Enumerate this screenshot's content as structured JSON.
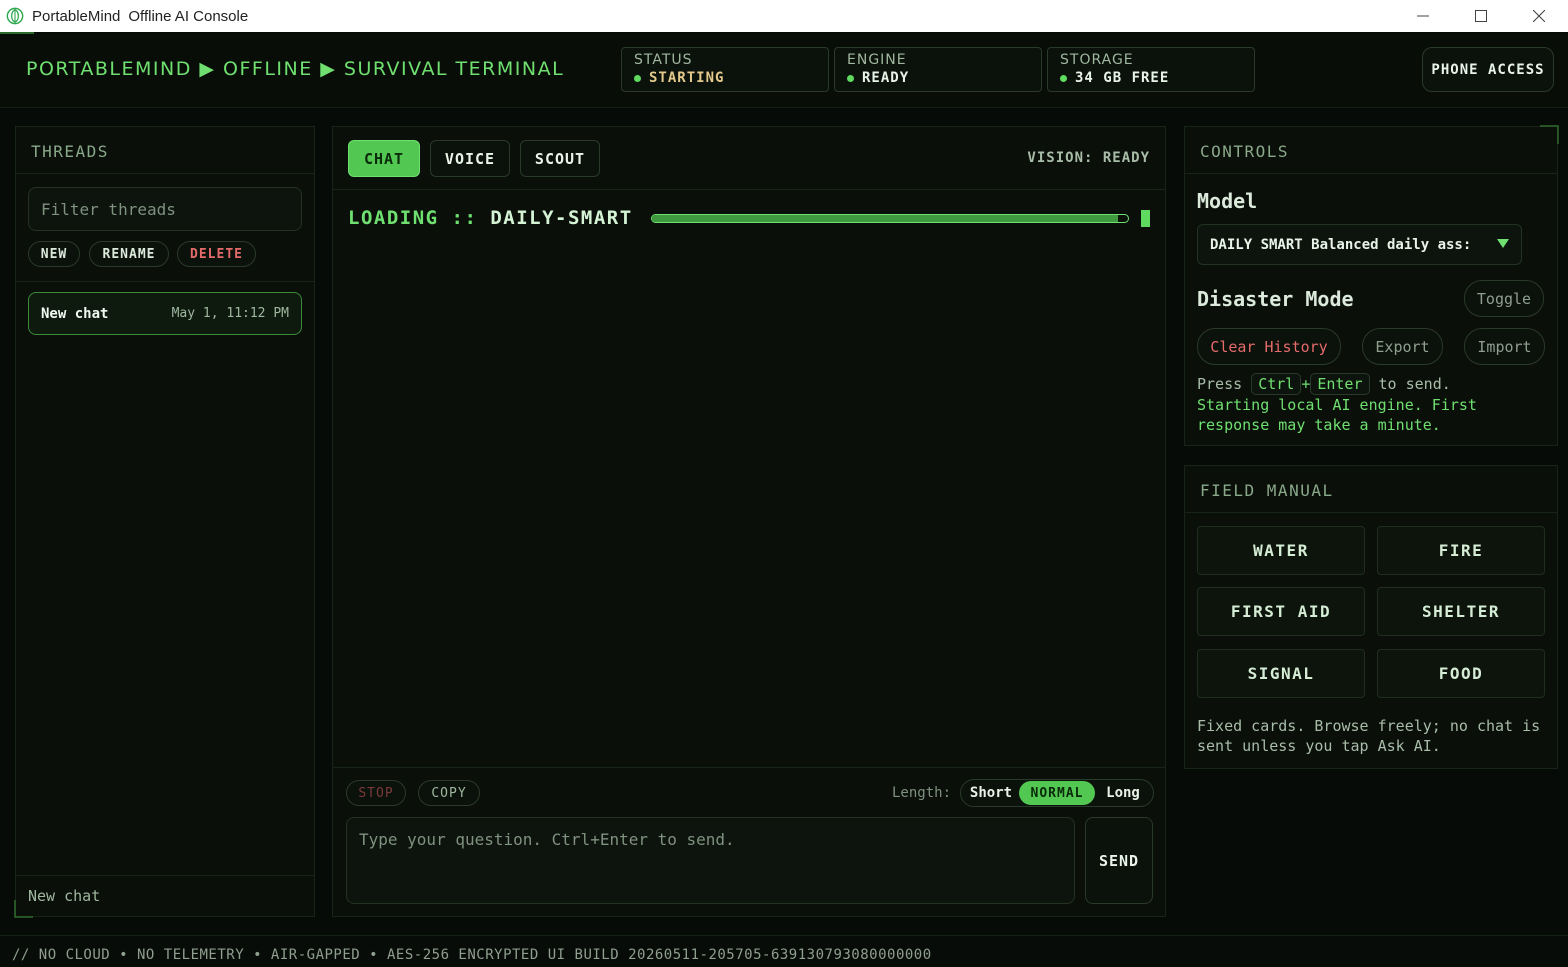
{
  "window": {
    "app_name": "PortableMind",
    "title": "Offline AI Console"
  },
  "header": {
    "brand": "PORTABLEMIND ▶ OFFLINE ▶ SURVIVAL TERMINAL",
    "status": {
      "label": "STATUS",
      "value": "STARTING"
    },
    "engine": {
      "label": "ENGINE",
      "value": "READY"
    },
    "storage": {
      "label": "STORAGE",
      "value": "34 GB FREE"
    },
    "phone_access": "PHONE ACCESS"
  },
  "threads": {
    "heading": "THREADS",
    "filter_placeholder": "Filter threads",
    "actions": {
      "new": "NEW",
      "rename": "RENAME",
      "delete": "DELETE"
    },
    "items": [
      {
        "name": "New chat",
        "date": "May 1, 11:12 PM"
      }
    ],
    "footer": "New chat"
  },
  "center": {
    "tabs": [
      "CHAT",
      "VOICE",
      "SCOUT"
    ],
    "active_tab": "CHAT",
    "vision_status": "VISION: READY",
    "loading": {
      "prefix": "LOADING :: ",
      "model": "DAILY-SMART",
      "progress": 0.98
    },
    "stop": "STOP",
    "copy": "COPY",
    "length_label": "Length:",
    "length_options": [
      "Short",
      "NORMAL",
      "Long"
    ],
    "length_selected": "NORMAL",
    "prompt_placeholder": "Type your question. Ctrl+Enter to send.",
    "send": "SEND"
  },
  "controls": {
    "heading": "CONTROLS",
    "model_label": "Model",
    "model_value": "DAILY SMART Balanced daily ass:",
    "disaster_mode_label": "Disaster Mode",
    "toggle": "Toggle",
    "clear_history": "Clear History",
    "export": "Export",
    "import": "Import",
    "hint_press": "Press",
    "hint_key1": "Ctrl",
    "hint_plus": "+",
    "hint_key2": "Enter",
    "hint_suffix": "to send.",
    "hint_status": "Starting local AI engine. First response may take a minute."
  },
  "field_manual": {
    "heading": "FIELD MANUAL",
    "cards": [
      "WATER",
      "FIRE",
      "FIRST AID",
      "SHELTER",
      "SIGNAL",
      "FOOD"
    ],
    "note": "Fixed cards. Browse freely; no chat is sent unless you tap Ask AI."
  },
  "footer": "// NO CLOUD • NO TELEMETRY • AIR-GAPPED • AES-256 ENCRYPTED UI BUILD 20260511-205705-639130793080000000",
  "colors": {
    "accent": "#52c852",
    "brand_text": "#6fe06f",
    "background": "#070b07",
    "danger": "#e56b6b",
    "warn": "#e3c98b"
  }
}
